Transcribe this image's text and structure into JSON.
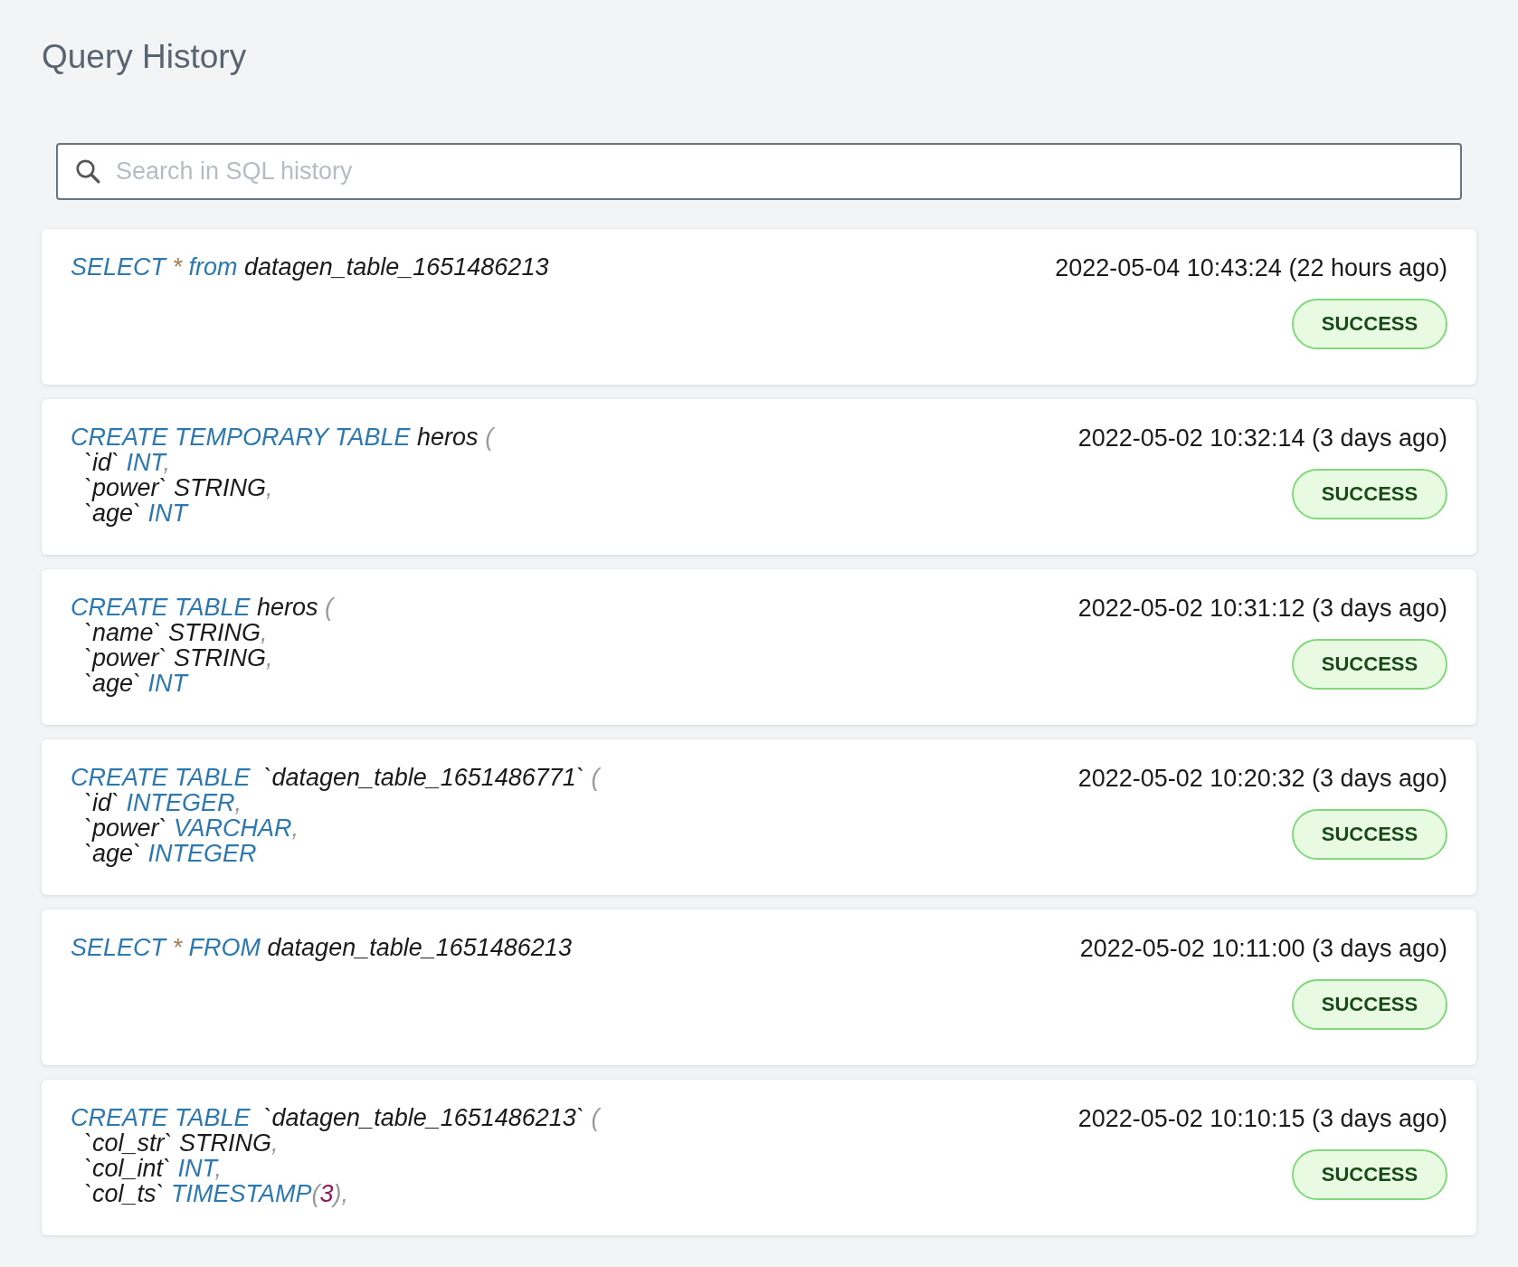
{
  "title": "Query History",
  "search": {
    "placeholder": "Search in SQL history"
  },
  "queries": [
    {
      "lines": [
        [
          {
            "kind": "kw",
            "text": "SELECT "
          },
          {
            "kind": "op",
            "text": "*"
          },
          {
            "kind": "kw",
            "text": " from "
          },
          {
            "kind": "id",
            "text": "datagen_table_1651486213"
          }
        ]
      ],
      "time": "2022-05-04 10:43:24 (22 hours ago)",
      "status": "SUCCESS"
    },
    {
      "lines": [
        [
          {
            "kind": "kw",
            "text": "CREATE TEMPORARY TABLE "
          },
          {
            "kind": "id",
            "text": "heros "
          },
          {
            "kind": "punct",
            "text": "("
          }
        ],
        [
          {
            "kind": "id",
            "text": "  `id` "
          },
          {
            "kind": "kw",
            "text": "INT"
          },
          {
            "kind": "punct",
            "text": ","
          }
        ],
        [
          {
            "kind": "id",
            "text": "  `power` STRING"
          },
          {
            "kind": "punct",
            "text": ","
          }
        ],
        [
          {
            "kind": "id",
            "text": "  `age` "
          },
          {
            "kind": "kw",
            "text": "INT"
          }
        ]
      ],
      "time": "2022-05-02 10:32:14 (3 days ago)",
      "status": "SUCCESS"
    },
    {
      "lines": [
        [
          {
            "kind": "kw",
            "text": "CREATE TABLE "
          },
          {
            "kind": "id",
            "text": "heros "
          },
          {
            "kind": "punct",
            "text": "("
          }
        ],
        [
          {
            "kind": "id",
            "text": "  `name` STRING"
          },
          {
            "kind": "punct",
            "text": ","
          }
        ],
        [
          {
            "kind": "id",
            "text": "  `power` STRING"
          },
          {
            "kind": "punct",
            "text": ","
          }
        ],
        [
          {
            "kind": "id",
            "text": "  `age` "
          },
          {
            "kind": "kw",
            "text": "INT"
          }
        ]
      ],
      "time": "2022-05-02 10:31:12 (3 days ago)",
      "status": "SUCCESS"
    },
    {
      "lines": [
        [
          {
            "kind": "kw",
            "text": "CREATE TABLE "
          },
          {
            "kind": "id",
            "text": " `datagen_table_1651486771` "
          },
          {
            "kind": "punct",
            "text": "("
          }
        ],
        [
          {
            "kind": "id",
            "text": "  `id` "
          },
          {
            "kind": "kw",
            "text": "INTEGER"
          },
          {
            "kind": "punct",
            "text": ","
          }
        ],
        [
          {
            "kind": "id",
            "text": "  `power` "
          },
          {
            "kind": "kw",
            "text": "VARCHAR"
          },
          {
            "kind": "punct",
            "text": ","
          }
        ],
        [
          {
            "kind": "id",
            "text": "  `age` "
          },
          {
            "kind": "kw",
            "text": "INTEGER"
          }
        ]
      ],
      "time": "2022-05-02 10:20:32 (3 days ago)",
      "status": "SUCCESS"
    },
    {
      "lines": [
        [
          {
            "kind": "kw",
            "text": "SELECT "
          },
          {
            "kind": "op",
            "text": "*"
          },
          {
            "kind": "kw",
            "text": " FROM "
          },
          {
            "kind": "id",
            "text": "datagen_table_1651486213"
          }
        ]
      ],
      "time": "2022-05-02 10:11:00 (3 days ago)",
      "status": "SUCCESS"
    },
    {
      "lines": [
        [
          {
            "kind": "kw",
            "text": "CREATE TABLE "
          },
          {
            "kind": "id",
            "text": " `datagen_table_1651486213` "
          },
          {
            "kind": "punct",
            "text": "("
          }
        ],
        [
          {
            "kind": "id",
            "text": "  `col_str` STRING"
          },
          {
            "kind": "punct",
            "text": ","
          }
        ],
        [
          {
            "kind": "id",
            "text": "  `col_int` "
          },
          {
            "kind": "kw",
            "text": "INT"
          },
          {
            "kind": "punct",
            "text": ","
          }
        ],
        [
          {
            "kind": "id",
            "text": "  `col_ts` "
          },
          {
            "kind": "kw",
            "text": "TIMESTAMP"
          },
          {
            "kind": "punct",
            "text": "("
          },
          {
            "kind": "num",
            "text": "3"
          },
          {
            "kind": "punct",
            "text": "),"
          }
        ]
      ],
      "time": "2022-05-02 10:10:15 (3 days ago)",
      "status": "SUCCESS"
    }
  ]
}
